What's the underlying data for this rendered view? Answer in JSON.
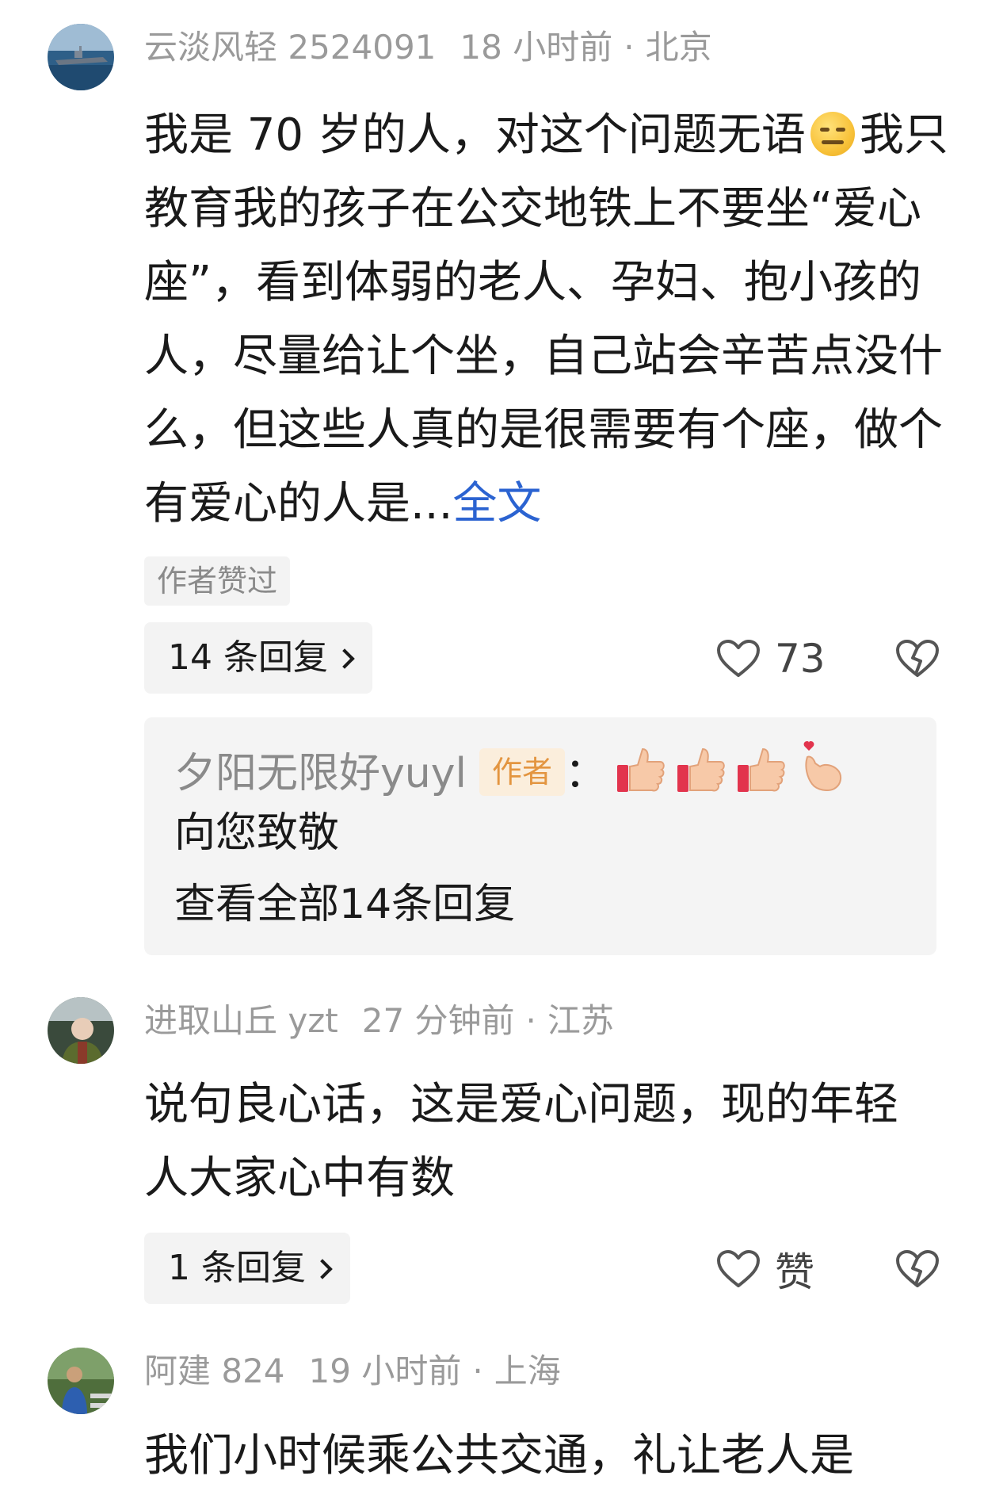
{
  "comments": [
    {
      "username": "云淡风轻 2524091",
      "time": "18 小时前",
      "sep": "·",
      "location": "北京",
      "text_line1_a": "我是 70 岁的人，对这个问题无语",
      "text_line1_b": "我",
      "text_rest": "只教育我的孩子在公交地铁上不要坐“爱心座”，看到体弱的老人、孕妇、抱小孩的人，尽量给让个坐，自己站会辛苦点没什么，但这些人真的是很需要有个座，做个有爱心的人是...",
      "more": "全文",
      "emoji": "neutral-face-icon",
      "badge": "作者赞过",
      "reply_count_label": "14 条回复",
      "like_count": "73",
      "top_reply": {
        "author": "夕阳无限好yuyl",
        "author_tag": "作者",
        "colon": "：",
        "text": "向您致敬",
        "view_all": "查看全部14条回复"
      }
    },
    {
      "username": "进取山丘 yzt",
      "time": "27 分钟前",
      "sep": "·",
      "location": "江苏",
      "text": "说句良心话，这是爱心问题，现的年轻人大家心中有数",
      "reply_count_label": "1 条回复",
      "like_label": "赞"
    },
    {
      "username": "阿建 824",
      "time": "19 小时前",
      "sep": "·",
      "location": "上海",
      "text": "我们小时候乘公共交通，礼让老人是"
    }
  ]
}
